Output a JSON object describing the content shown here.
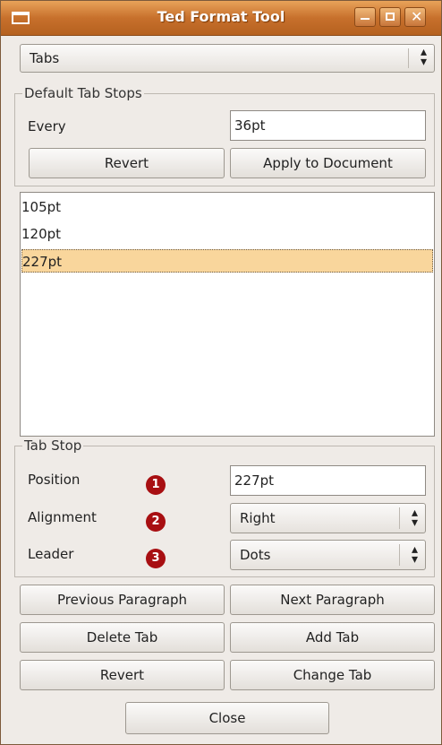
{
  "window": {
    "title": "Ted Format Tool"
  },
  "page_selector": {
    "value": "Tabs"
  },
  "default_tab_stops": {
    "group_label": "Default Tab Stops",
    "every_label": "Every",
    "every_value": "36pt",
    "revert_label": "Revert",
    "apply_label": "Apply to Document"
  },
  "tab_list": {
    "items": [
      "105pt",
      "120pt",
      "227pt"
    ],
    "selected_index": 2
  },
  "tab_stop": {
    "group_label": "Tab Stop",
    "position_label": "Position",
    "position_value": "227pt",
    "alignment_label": "Alignment",
    "alignment_value": "Right",
    "leader_label": "Leader",
    "leader_value": "Dots",
    "badges": [
      "1",
      "2",
      "3"
    ]
  },
  "buttons": {
    "previous_paragraph": "Previous Paragraph",
    "next_paragraph": "Next Paragraph",
    "delete_tab": "Delete Tab",
    "add_tab": "Add Tab",
    "revert": "Revert",
    "change_tab": "Change Tab",
    "close": "Close"
  },
  "colors": {
    "title_bar": "#c7702c",
    "selection": "#f9d69c",
    "badge": "#a80f12"
  }
}
